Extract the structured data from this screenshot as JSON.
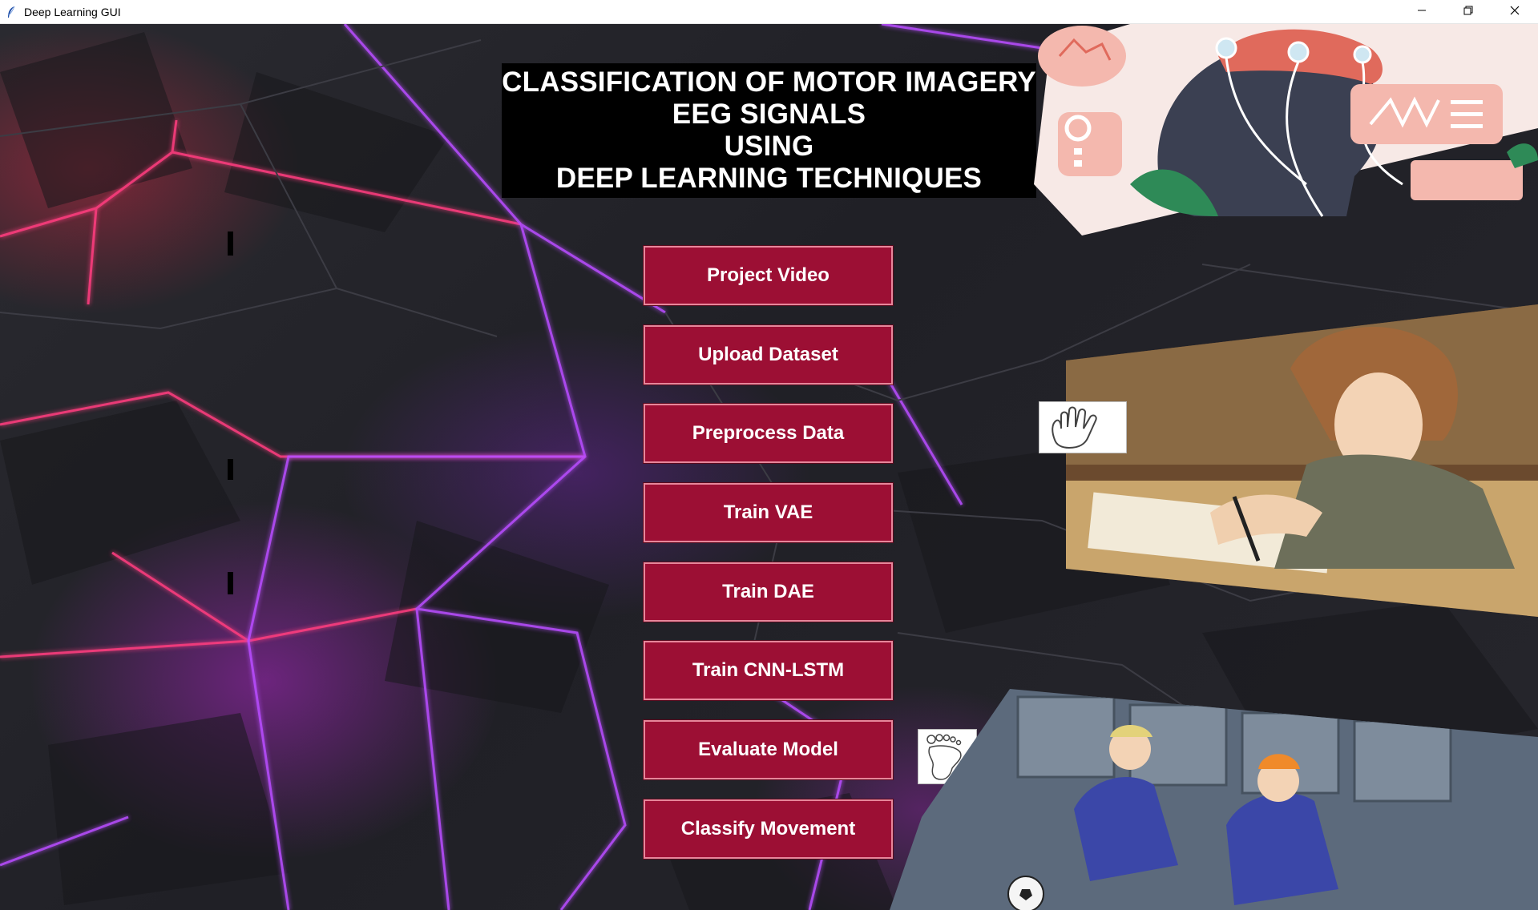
{
  "window": {
    "title": "Deep Learning GUI",
    "icons": [
      "feather-icon",
      "minimize-icon",
      "restore-icon",
      "close-icon"
    ]
  },
  "header": {
    "lines": [
      "CLASSIFICATION OF MOTOR IMAGERY",
      "EEG SIGNALS",
      "USING",
      "DEEP LEARNING TECHNIQUES"
    ]
  },
  "buttons": [
    "Project Video",
    "Upload Dataset",
    "Preprocess Data",
    "Train VAE",
    "Train DAE",
    "Train CNN-LSTM",
    "Evaluate Model",
    "Classify Movement"
  ],
  "images": {
    "top_right": "eeg-head-illustration",
    "middle_right": "student-writing-illustration",
    "bottom_right": "soccer-players-illustration",
    "hand_icon": "hand-icon",
    "foot_icon": "foot-icon"
  },
  "colors": {
    "button_fill": "#9c0f34",
    "button_border": "#e6869a",
    "title_panel": "#000000",
    "neon_pink": "#ff3d7f",
    "neon_purple": "#b84dff"
  }
}
